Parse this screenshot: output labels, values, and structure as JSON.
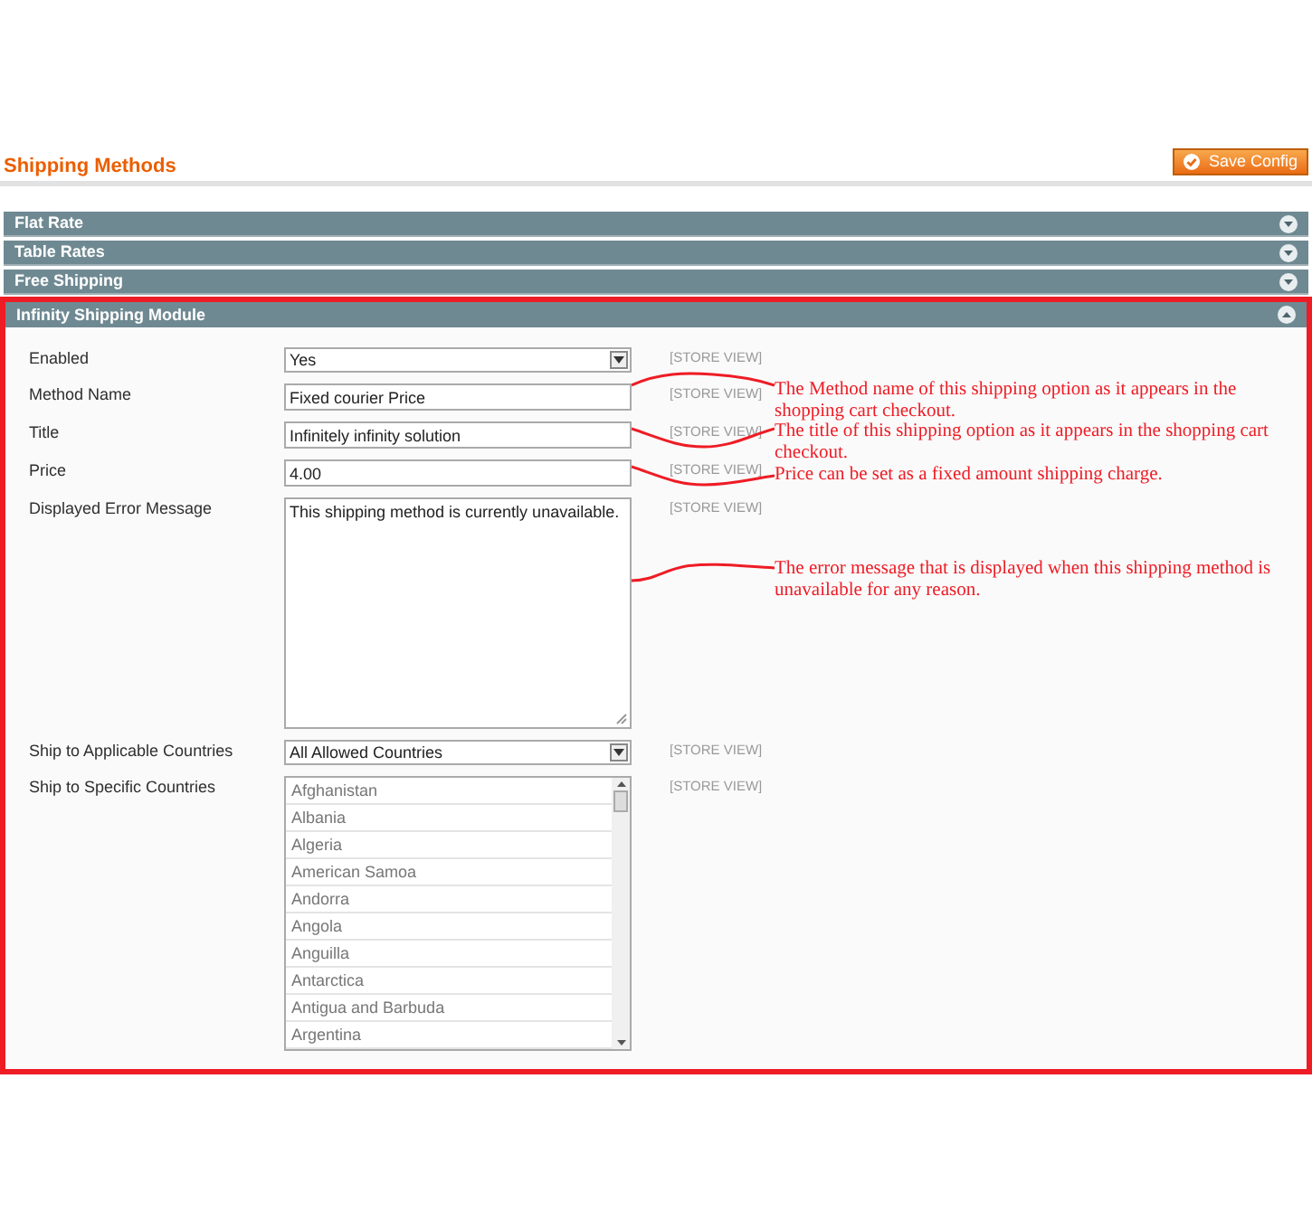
{
  "header": {
    "title": "Shipping Methods",
    "save_button": "Save Config"
  },
  "sections": [
    {
      "title": "Flat Rate",
      "expanded": false
    },
    {
      "title": "Table Rates",
      "expanded": false
    },
    {
      "title": "Free Shipping",
      "expanded": false
    },
    {
      "title": "Infinity Shipping Module",
      "expanded": true
    }
  ],
  "fields": [
    {
      "kind": "select",
      "label": "Enabled",
      "value": "Yes",
      "scope": "[STORE VIEW]"
    },
    {
      "kind": "text",
      "label": "Method Name",
      "value": "Fixed courier Price",
      "scope": "[STORE VIEW]",
      "note": "The Method name of this shipping option as it appears in the shopping cart checkout."
    },
    {
      "kind": "text",
      "label": "Title",
      "value": "Infinitely infinity solution",
      "scope": "[STORE VIEW]",
      "note": "The title of this shipping option as it appears in the shopping cart checkout."
    },
    {
      "kind": "text",
      "label": "Price",
      "value": "4.00",
      "scope": "[STORE VIEW]",
      "note": "Price can be set as a fixed amount shipping charge."
    },
    {
      "kind": "textarea",
      "label": "Displayed Error Message",
      "value": "This shipping method is currently unavailable.",
      "scope": "[STORE VIEW]",
      "note": "The error message that is displayed when this shipping method is unavailable for any reason."
    },
    {
      "kind": "select",
      "label": "Ship to Applicable Countries",
      "value": "All Allowed Countries",
      "scope": "[STORE VIEW]"
    },
    {
      "kind": "multiselect",
      "label": "Ship to Specific Countries",
      "scope": "[STORE VIEW]",
      "options": [
        "Afghanistan",
        "Albania",
        "Algeria",
        "American Samoa",
        "Andorra",
        "Angola",
        "Anguilla",
        "Antarctica",
        "Antigua and Barbuda",
        "Argentina"
      ]
    }
  ]
}
